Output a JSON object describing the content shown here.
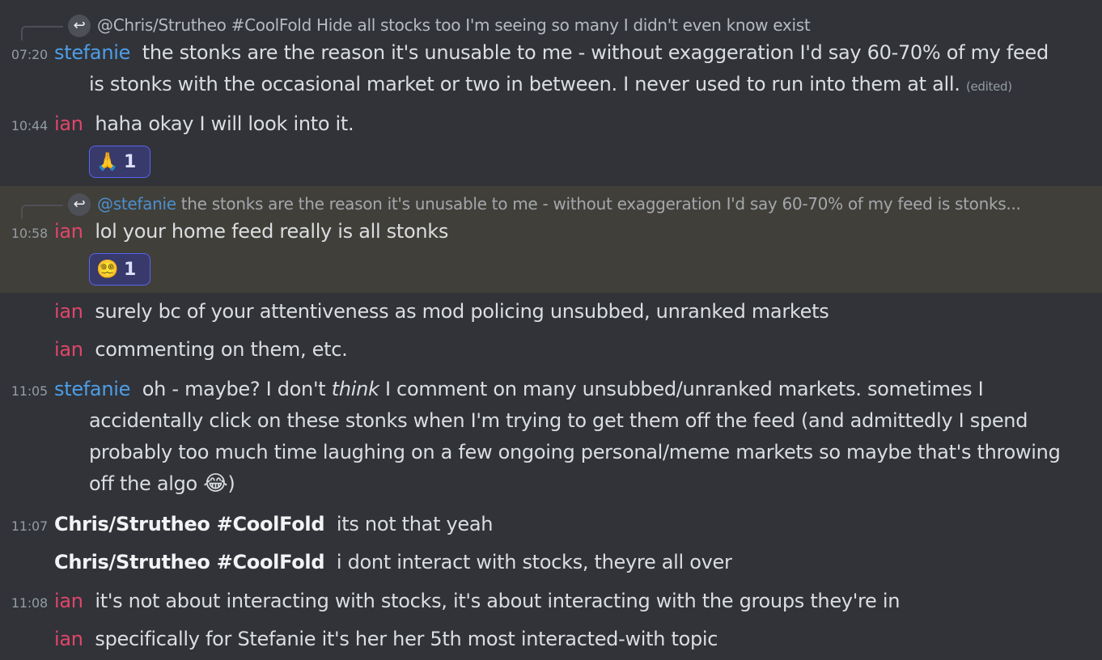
{
  "messages": [
    {
      "reply": {
        "author": "@Chris/Strutheo #CoolFold",
        "text": "Hide all stocks too I'm seeing so many I didn't even know exist"
      },
      "time": "07:20",
      "author": "stefanie",
      "line1": "the stonks are the reason it's unusable to me - without exaggeration I'd say 60-70% of my feed",
      "line2": "is stonks with the occasional market or two in between. I never used to run into them at all.",
      "edited": "(edited)"
    },
    {
      "time": "10:44",
      "author": "ian",
      "text": "haha okay I will look into it.",
      "reaction": {
        "emoji": "🙏",
        "count": "1"
      }
    },
    {
      "reply": {
        "author": "@stefanie",
        "text": "the stonks are the reason it's unusable to me - without exaggeration I'd say 60-70% of my feed is stonks..."
      },
      "time": "10:58",
      "author": "ian",
      "text": "lol your home feed really is all stonks",
      "reaction": {
        "emoji": "😵‍💫",
        "count": "1"
      }
    },
    {
      "author": "ian",
      "text": "surely bc of your attentiveness as mod policing unsubbed, unranked markets"
    },
    {
      "author": "ian",
      "text": "commenting on them, etc."
    },
    {
      "time": "11:05",
      "author": "stefanie",
      "line1_a": "oh - maybe? I don't ",
      "line1_em": "think",
      "line1_b": " I comment on many unsubbed/unranked markets. sometimes I",
      "line2": "accidentally click on these stonks when I'm trying to get them off the feed (and admittedly I spend",
      "line3": "probably too much time laughing on a few ongoing personal/meme markets so maybe that's throwing",
      "line4_a": "off the algo ",
      "line4_emoji": "😂",
      "line4_b": ")"
    },
    {
      "time": "11:07",
      "author": "Chris/Strutheo #CoolFold",
      "text": "its not that yeah"
    },
    {
      "author": "Chris/Strutheo #CoolFold",
      "text": "i dont interact with stocks, theyre all over"
    },
    {
      "time": "11:08",
      "author": "ian",
      "text": "it's not about interacting with stocks, it's about interacting with the groups they're in"
    },
    {
      "author": "ian",
      "text": "specifically for Stefanie it's her her 5th most interacted-with topic"
    }
  ],
  "colors": {
    "background": "#313338",
    "highlight": "#413f39",
    "stefanie": "#4e9ee8",
    "ian": "#e0466b",
    "reaction_border": "#5865f2"
  }
}
